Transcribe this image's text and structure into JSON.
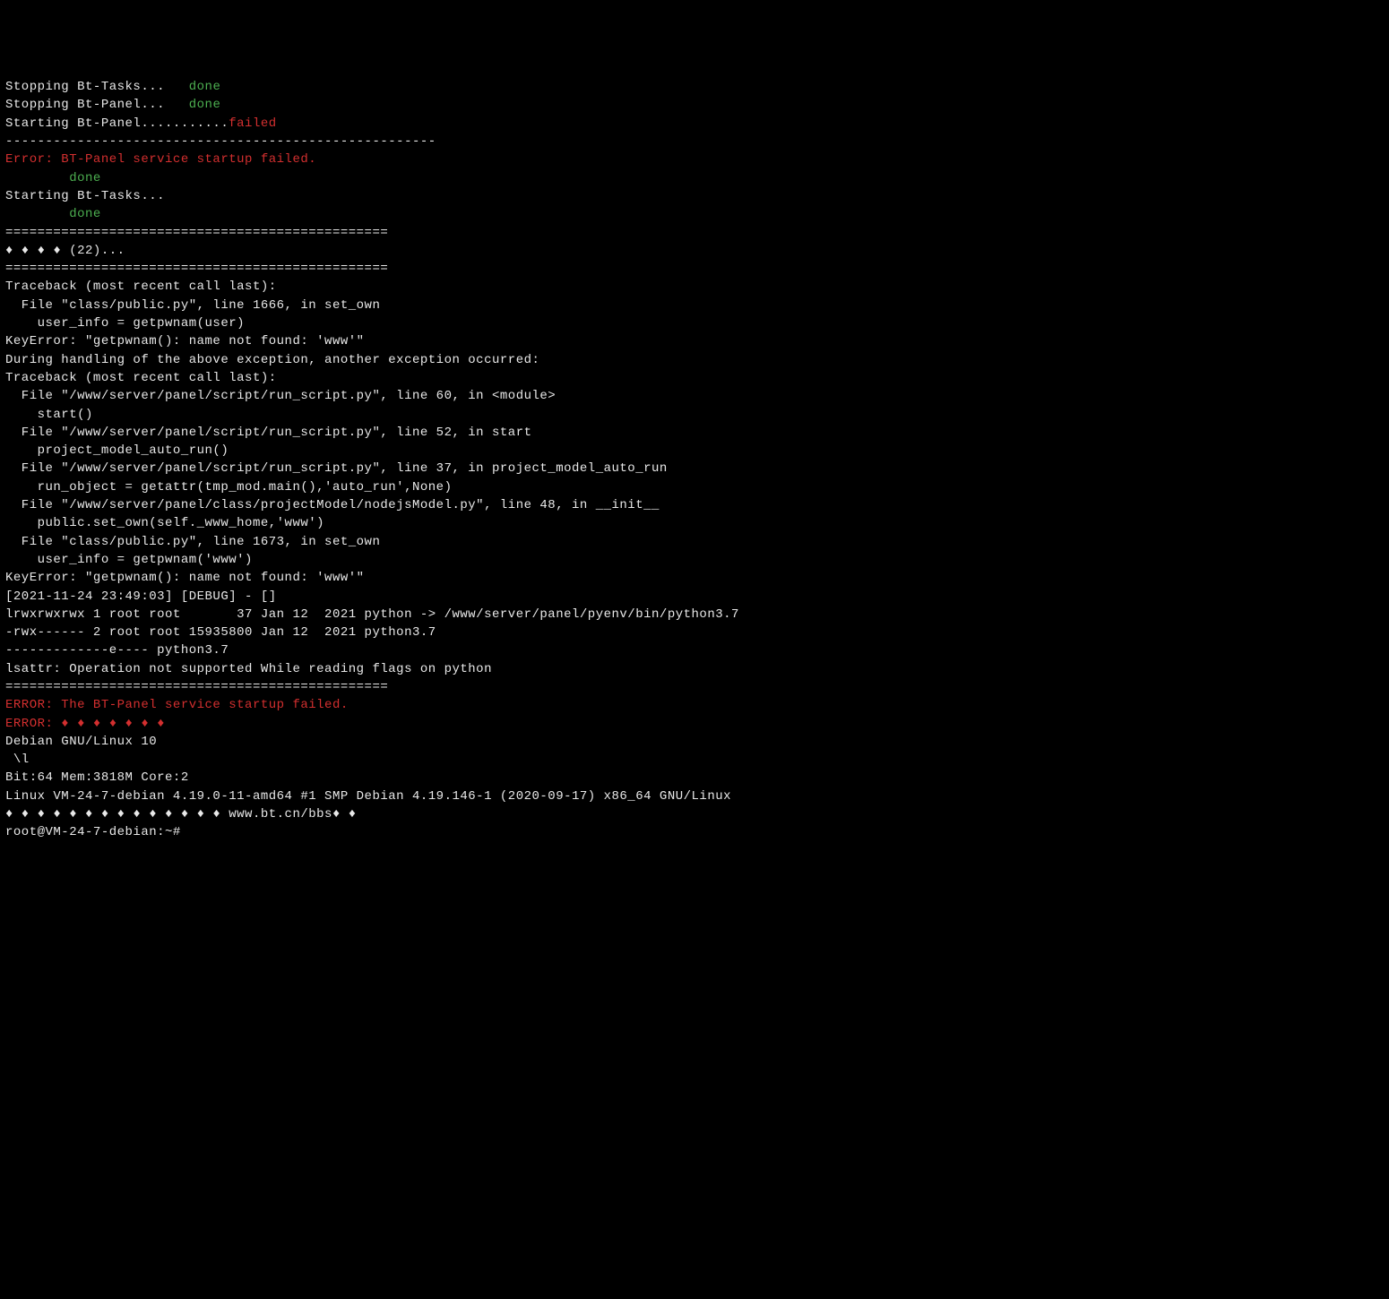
{
  "terminal": {
    "lines": [
      {
        "segments": [
          {
            "text": "Stopping Bt-Tasks...   ",
            "color": "white"
          },
          {
            "text": "done",
            "color": "green"
          }
        ]
      },
      {
        "segments": [
          {
            "text": "Stopping Bt-Panel...   ",
            "color": "white"
          },
          {
            "text": "done",
            "color": "green"
          }
        ]
      },
      {
        "segments": [
          {
            "text": "Starting Bt-Panel...........",
            "color": "white"
          },
          {
            "text": "failed",
            "color": "red"
          }
        ]
      },
      {
        "segments": [
          {
            "text": "------------------------------------------------------",
            "color": "white"
          }
        ]
      },
      {
        "segments": [
          {
            "text": "",
            "color": "white"
          }
        ]
      },
      {
        "segments": [
          {
            "text": "Error: BT-Panel service startup failed.",
            "color": "red"
          }
        ]
      },
      {
        "segments": [
          {
            "text": "        done",
            "color": "green"
          }
        ]
      },
      {
        "segments": [
          {
            "text": "Starting Bt-Tasks...",
            "color": "white"
          }
        ]
      },
      {
        "segments": [
          {
            "text": "        done",
            "color": "green"
          }
        ]
      },
      {
        "segments": [
          {
            "text": "================================================",
            "color": "white"
          }
        ]
      },
      {
        "segments": [
          {
            "text": "♦ ♦ ♦ ♦ (22)...",
            "color": "white"
          }
        ]
      },
      {
        "segments": [
          {
            "text": "================================================",
            "color": "white"
          }
        ]
      },
      {
        "segments": [
          {
            "text": "Traceback (most recent call last):",
            "color": "white"
          }
        ]
      },
      {
        "segments": [
          {
            "text": "  File \"class/public.py\", line 1666, in set_own",
            "color": "white"
          }
        ]
      },
      {
        "segments": [
          {
            "text": "    user_info = getpwnam(user)",
            "color": "white"
          }
        ]
      },
      {
        "segments": [
          {
            "text": "KeyError: \"getpwnam(): name not found: 'www'\"",
            "color": "white"
          }
        ]
      },
      {
        "segments": [
          {
            "text": "",
            "color": "white"
          }
        ]
      },
      {
        "segments": [
          {
            "text": "During handling of the above exception, another exception occurred:",
            "color": "white"
          }
        ]
      },
      {
        "segments": [
          {
            "text": "",
            "color": "white"
          }
        ]
      },
      {
        "segments": [
          {
            "text": "Traceback (most recent call last):",
            "color": "white"
          }
        ]
      },
      {
        "segments": [
          {
            "text": "  File \"/www/server/panel/script/run_script.py\", line 60, in <module>",
            "color": "white"
          }
        ]
      },
      {
        "segments": [
          {
            "text": "    start()",
            "color": "white"
          }
        ]
      },
      {
        "segments": [
          {
            "text": "  File \"/www/server/panel/script/run_script.py\", line 52, in start",
            "color": "white"
          }
        ]
      },
      {
        "segments": [
          {
            "text": "    project_model_auto_run()",
            "color": "white"
          }
        ]
      },
      {
        "segments": [
          {
            "text": "  File \"/www/server/panel/script/run_script.py\", line 37, in project_model_auto_run",
            "color": "white"
          }
        ]
      },
      {
        "segments": [
          {
            "text": "    run_object = getattr(tmp_mod.main(),'auto_run',None)",
            "color": "white"
          }
        ]
      },
      {
        "segments": [
          {
            "text": "  File \"/www/server/panel/class/projectModel/nodejsModel.py\", line 48, in __init__",
            "color": "white"
          }
        ]
      },
      {
        "segments": [
          {
            "text": "    public.set_own(self._www_home,'www')",
            "color": "white"
          }
        ]
      },
      {
        "segments": [
          {
            "text": "  File \"class/public.py\", line 1673, in set_own",
            "color": "white"
          }
        ]
      },
      {
        "segments": [
          {
            "text": "    user_info = getpwnam('www')",
            "color": "white"
          }
        ]
      },
      {
        "segments": [
          {
            "text": "KeyError: \"getpwnam(): name not found: 'www'\"",
            "color": "white"
          }
        ]
      },
      {
        "segments": [
          {
            "text": "[2021-11-24 23:49:03] [DEBUG] - []",
            "color": "white"
          }
        ]
      },
      {
        "segments": [
          {
            "text": "lrwxrwxrwx 1 root root       37 Jan 12  2021 python -> /www/server/panel/pyenv/bin/python3.7",
            "color": "white"
          }
        ]
      },
      {
        "segments": [
          {
            "text": "-rwx------ 2 root root 15935800 Jan 12  2021 python3.7",
            "color": "white"
          }
        ]
      },
      {
        "segments": [
          {
            "text": "-------------e---- python3.7",
            "color": "white"
          }
        ]
      },
      {
        "segments": [
          {
            "text": "lsattr: Operation not supported While reading flags on python",
            "color": "white"
          }
        ]
      },
      {
        "segments": [
          {
            "text": "================================================",
            "color": "white"
          }
        ]
      },
      {
        "segments": [
          {
            "text": "ERROR: The BT-Panel service startup failed.",
            "color": "red"
          }
        ]
      },
      {
        "segments": [
          {
            "text": "ERROR: ♦ ♦ ♦ ♦ ♦ ♦ ♦",
            "color": "red"
          }
        ]
      },
      {
        "segments": [
          {
            "text": "Debian GNU/Linux 10",
            "color": "white"
          }
        ]
      },
      {
        "segments": [
          {
            "text": " \\l",
            "color": "white"
          }
        ]
      },
      {
        "segments": [
          {
            "text": "Bit:64 Mem:3818M Core:2",
            "color": "white"
          }
        ]
      },
      {
        "segments": [
          {
            "text": "Linux VM-24-7-debian 4.19.0-11-amd64 #1 SMP Debian 4.19.146-1 (2020-09-17) x86_64 GNU/Linux",
            "color": "white"
          }
        ]
      },
      {
        "segments": [
          {
            "text": "♦ ♦ ♦ ♦ ♦ ♦ ♦ ♦ ♦ ♦ ♦ ♦ ♦ ♦ www.bt.cn/bbs♦ ♦",
            "color": "white"
          }
        ]
      },
      {
        "segments": [
          {
            "text": "root@VM-24-7-debian:~#",
            "color": "white"
          }
        ]
      }
    ]
  }
}
